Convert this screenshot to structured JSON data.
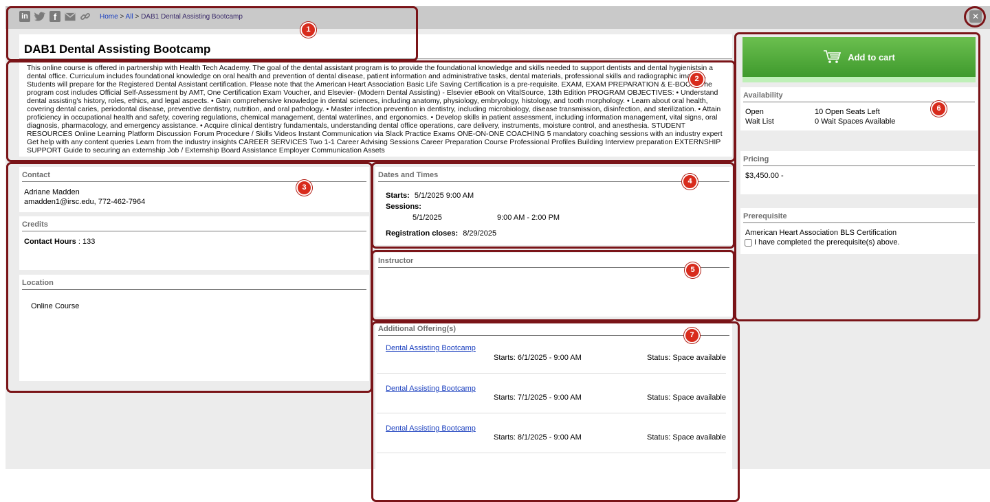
{
  "share_icons": [
    "linkedin-icon",
    "twitter-icon",
    "facebook-icon",
    "email-icon",
    "link-icon"
  ],
  "breadcrumb": {
    "home": "Home",
    "sep1": ">",
    "all": "All",
    "sep2": ">",
    "current": "DAB1  Dental Assisting Bootcamp"
  },
  "course": {
    "title": "DAB1  Dental Assisting Bootcamp",
    "description": "This online course is offered in partnership with Health Tech Academy. The goal of the dental assistant program is to provide the foundational knowledge and skills needed to support dentists and dental hygienistsin a dental office. Curriculum includes foundational knowledge on oral health and prevention of dental disease, patient information and administrative tasks, dental materials, professional skills and radiographic imaging. Students will prepare for the Registered Dental Assistant certification. Please note that the American Heart Association Basic Life Saving Certification is a pre-requisite. EXAM, EXAM PREPARATION & E-BOOK: The program cost includes Official Self-Assessment by AMT, One Certification Exam Voucher, and Elsevier- (Modern Dental Assisting) - Elsevier eBook on VitalSource, 13th Edition PROGRAM OBJECTIVES: • Understand dental assisting's history, roles, ethics, and legal aspects. • Gain comprehensive knowledge in dental sciences, including anatomy, physiology, embryology, histology, and tooth morphology. • Learn about oral health, covering dental caries, periodontal disease, preventive dentistry, nutrition, and oral pathology. • Master infection prevention in dentistry, including microbiology, disease transmission, disinfection, and sterilization. • Attain proficiency in occupational health and safety, covering regulations, chemical management, dental waterlines, and ergonomics. • Develop skills in patient assessment, including information management, vital signs, oral diagnosis, pharmacology, and emergency assistance. • Acquire clinical dentistry fundamentals, understanding dental office operations, care delivery, instruments, moisture control, and anesthesia. STUDENT RESOURCES Online Learning Platform Discussion Forum Procedure / Skills Videos Instant Communication via Slack Practice Exams ONE-ON-ONE COACHING 5 mandatory coaching sessions with an industry expert Get help with any content queries Learn from the industry insights CAREER SERVICES Two 1-1 Career Advising Sessions Career Preparation Course Professional Profiles Building Interview preparation EXTERNSHIP SUPPORT Guide to securing an externship Job / Externship Board Assistance Employer Communication Assets"
  },
  "contact": {
    "header": "Contact",
    "name": "Adriane Madden",
    "email_phone": "amadden1@irsc.edu, 772-462-7964"
  },
  "credits": {
    "header": "Credits",
    "label": "Contact Hours",
    "sep": ":",
    "value": "133"
  },
  "location": {
    "header": "Location",
    "value": "Online Course"
  },
  "dates": {
    "header": "Dates and Times",
    "starts_label": "Starts:",
    "starts_value": "5/1/2025  9:00 AM",
    "sessions_label": "Sessions:",
    "session_date": "5/1/2025",
    "session_time": "9:00 AM - 2:00 PM",
    "reg_label": "Registration closes:",
    "reg_value": "8/29/2025"
  },
  "instructor": {
    "header": "Instructor"
  },
  "additional": {
    "header": "Additional Offering(s)",
    "offerings": [
      {
        "name": "Dental Assisting Bootcamp",
        "starts": "Starts: 6/1/2025 - 9:00 AM",
        "status": "Status: Space available"
      },
      {
        "name": "Dental Assisting Bootcamp",
        "starts": "Starts: 7/1/2025 - 9:00 AM",
        "status": "Status: Space available"
      },
      {
        "name": "Dental Assisting Bootcamp",
        "starts": "Starts: 8/1/2025 - 9:00 AM",
        "status": "Status: Space available"
      }
    ]
  },
  "cart": {
    "label": "Add to cart"
  },
  "availability": {
    "header": "Availability",
    "open_label": "Open",
    "open_value": "10 Open Seats Left",
    "wait_label": "Wait List",
    "wait_value": "0 Wait Spaces Available"
  },
  "pricing": {
    "header": "Pricing",
    "value": "$3,450.00 -"
  },
  "prerequisite": {
    "header": "Prerequisite",
    "name": "American Heart Association BLS Certification",
    "checkbox_label": "I have completed the prerequisite(s) above.",
    "checked": false
  },
  "callouts": [
    "1",
    "2",
    "3",
    "4",
    "5",
    "6",
    "7"
  ],
  "colors": {
    "callout_border": "#7a1418",
    "badge": "#d82b1c",
    "cart_green": "#4ea838",
    "link": "#1a3fbf"
  }
}
